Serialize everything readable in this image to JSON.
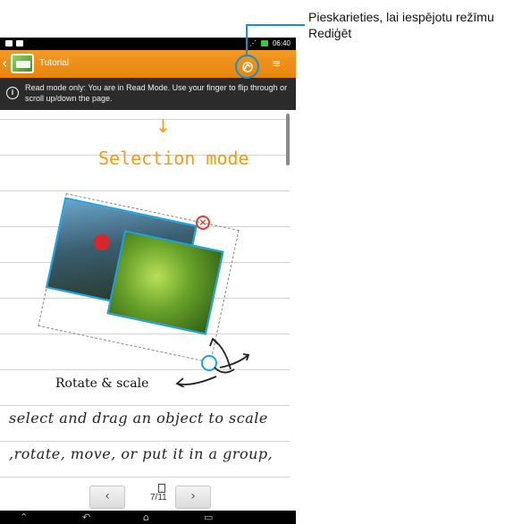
{
  "status_bar": {
    "time": "06:40"
  },
  "app_bar": {
    "title": "Tutorial",
    "menu_glyph": "≡"
  },
  "info_bar": {
    "message": "Read mode only: You are in Read Mode. Use your finger to flip through or scroll up/down the page."
  },
  "canvas": {
    "heading": "Selection mode",
    "rotate_label": "Rotate & scale",
    "handwriting_line1": "select and drag an object to scale",
    "handwriting_line2": ",rotate, move, or put it in a group,"
  },
  "pager": {
    "prev": "‹",
    "next": "›",
    "page": "7/11"
  },
  "callout": {
    "text": "Pieskarieties, lai iespējotu režīmu Rediģēt"
  },
  "colors": {
    "accent": "#f39a25",
    "highlight": "#1c8fd1"
  },
  "icons": [
    "back-icon",
    "app-logo-icon",
    "edit-mode-icon",
    "menu-icon",
    "info-icon",
    "close-icon",
    "page-icon",
    "nav-back-icon",
    "nav-home-icon",
    "nav-recent-icon",
    "nav-collapse-icon"
  ]
}
